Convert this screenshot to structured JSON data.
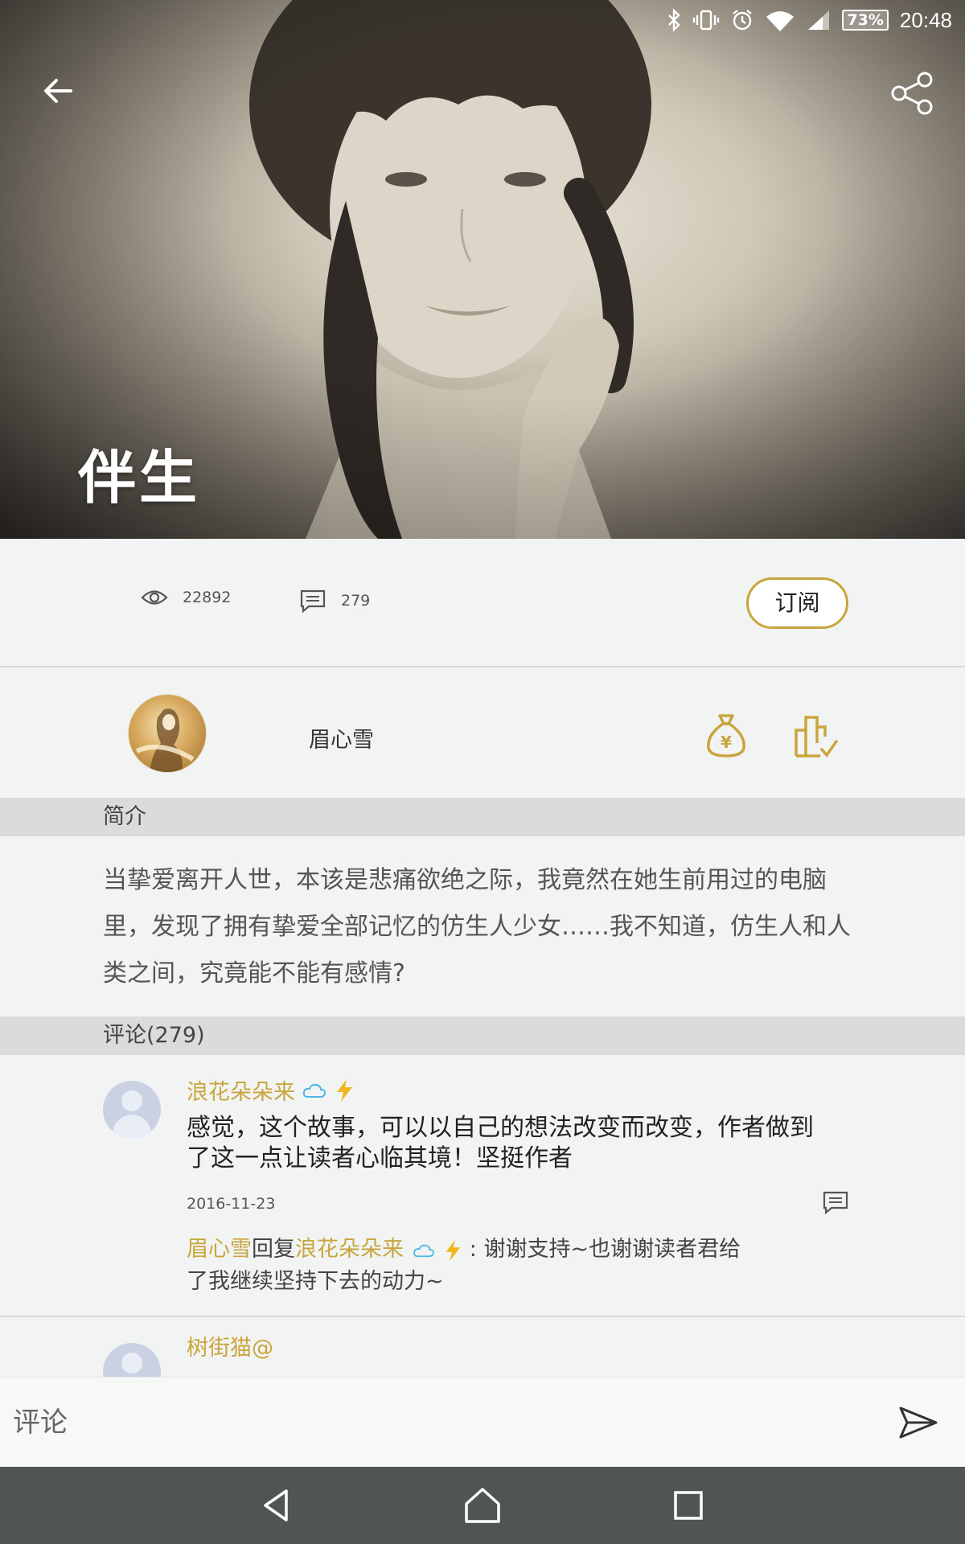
{
  "status_bar": {
    "battery": "73%",
    "time": "20:48"
  },
  "hero": {
    "title": "伴生"
  },
  "stats": {
    "views": "22892",
    "comments": "279",
    "subscribe_label": "订阅"
  },
  "author": {
    "name": "眉心雪"
  },
  "intro": {
    "header": "简介",
    "text": "当挚爱离开人世，本该是悲痛欲绝之际，我竟然在她生前用过的电脑里，发现了拥有挚爱全部记忆的仿生人少女……我不知道，仿生人和人类之间，究竟能不能有感情?"
  },
  "comments": {
    "header": "评论(279)",
    "items": [
      {
        "user": "浪花朵朵来",
        "text": "感觉，这个故事，可以以自己的想法改变而改变，作者做到了这一点让读者心临其境！坚挺作者",
        "date": "2016-11-23",
        "reply": {
          "from": "眉心雪",
          "verb": "回复",
          "to": "浪花朵朵来",
          "text": " : 谢谢支持~也谢谢读者君给了我继续坚持下去的动力~"
        }
      },
      {
        "user": "树街猫@"
      }
    ]
  },
  "input": {
    "placeholder": "评论"
  },
  "colors": {
    "accent": "#c9a53d",
    "background": "#f2f4f3",
    "section_header": "#d9dcdb",
    "navbar": "#4f5552"
  }
}
